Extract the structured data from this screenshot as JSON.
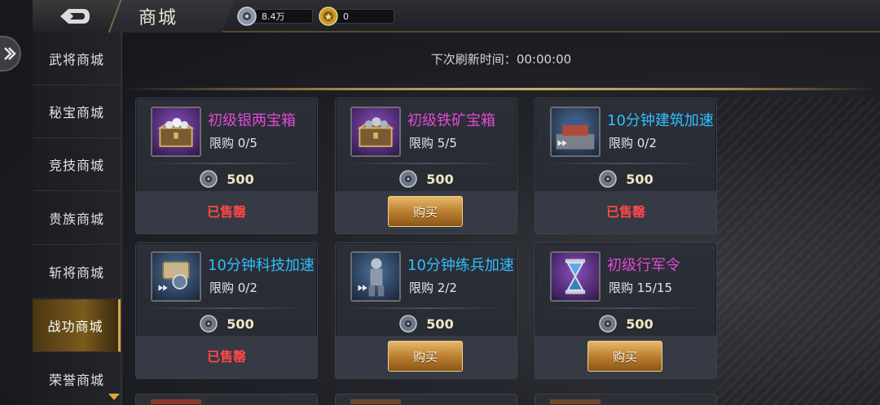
{
  "header": {
    "title": "商城",
    "resources": [
      {
        "icon": "silver-coin-icon",
        "value": "8.4万"
      },
      {
        "icon": "gold-medal-icon",
        "value": "0"
      }
    ]
  },
  "sidebar": {
    "items": [
      {
        "label": "武将商城",
        "active": false
      },
      {
        "label": "秘宝商城",
        "active": false
      },
      {
        "label": "竞技商城",
        "active": false
      },
      {
        "label": "贵族商城",
        "active": false
      },
      {
        "label": "斩将商城",
        "active": false
      },
      {
        "label": "战功商城",
        "active": true
      },
      {
        "label": "荣誉商城",
        "active": false
      }
    ]
  },
  "refresh": {
    "label": "下次刷新时间：",
    "time": "00:00:00"
  },
  "cards": [
    {
      "name": "初级银两宝箱",
      "name_color": "pink",
      "limit": "限购  0/5",
      "price": "500",
      "state": "sold",
      "state_label": "已售罄",
      "icon": "silver-chest-icon"
    },
    {
      "name": "初级铁矿宝箱",
      "name_color": "pink",
      "limit": "限购  5/5",
      "price": "500",
      "state": "buy",
      "state_label": "购买",
      "icon": "iron-chest-icon"
    },
    {
      "name": "10分钟建筑加速",
      "name_color": "cyan",
      "limit": "限购  0/2",
      "price": "500",
      "state": "sold",
      "state_label": "已售罄",
      "icon": "building-speedup-icon"
    },
    {
      "name": "10分钟科技加速",
      "name_color": "cyan",
      "limit": "限购  0/2",
      "price": "500",
      "state": "sold",
      "state_label": "已售罄",
      "icon": "tech-speedup-icon"
    },
    {
      "name": "10分钟练兵加速",
      "name_color": "cyan",
      "limit": "限购  2/2",
      "price": "500",
      "state": "buy",
      "state_label": "购买",
      "icon": "training-speedup-icon"
    },
    {
      "name": "初级行军令",
      "name_color": "pink",
      "limit": "限购  15/15",
      "price": "500",
      "state": "buy",
      "state_label": "购买",
      "icon": "hourglass-icon"
    }
  ]
}
